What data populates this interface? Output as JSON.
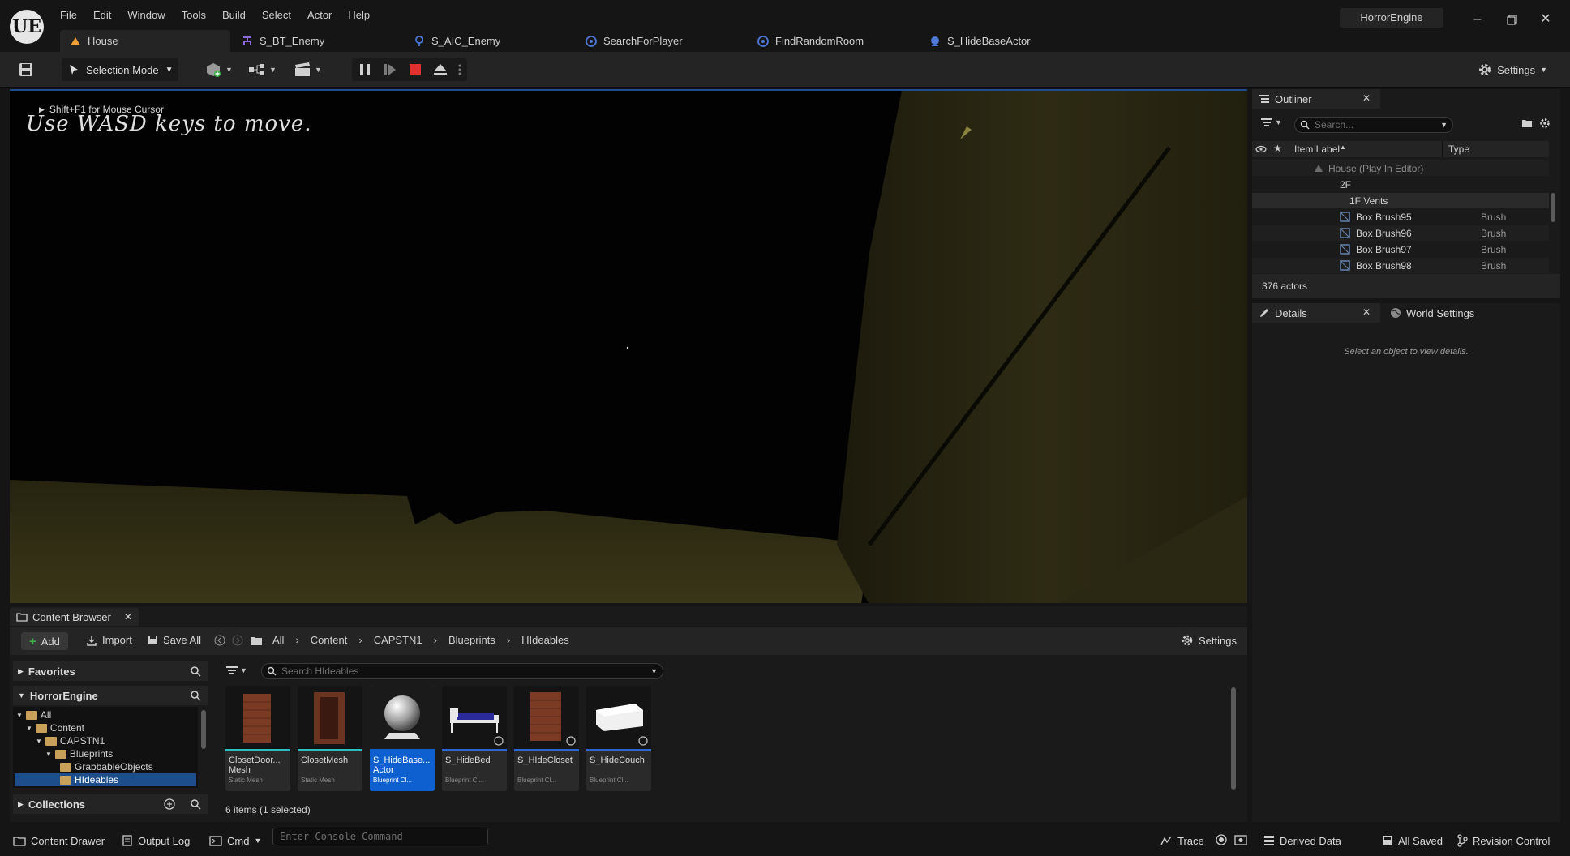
{
  "app": {
    "project": "HorrorEngine",
    "logo": "UE"
  },
  "menu": [
    "File",
    "Edit",
    "Window",
    "Tools",
    "Build",
    "Select",
    "Actor",
    "Help"
  ],
  "tabs": [
    {
      "label": "House",
      "icon": "level-icon",
      "active": true
    },
    {
      "label": "S_BT_Enemy",
      "icon": "behavior-tree-icon"
    },
    {
      "label": "S_AIC_Enemy",
      "icon": "blueprint-icon"
    },
    {
      "label": "SearchForPlayer",
      "icon": "blueprint-icon"
    },
    {
      "label": "FindRandomRoom",
      "icon": "blueprint-icon"
    },
    {
      "label": "S_HideBaseActor",
      "icon": "blueprint-icon"
    }
  ],
  "toolbar": {
    "selection_mode": "Selection Mode",
    "settings": "Settings"
  },
  "viewport": {
    "hint": "Shift+F1 for Mouse Cursor",
    "banner": "Use WASD keys to move."
  },
  "outliner": {
    "title": "Outliner",
    "search_placeholder": "Search...",
    "col_label": "Item Label",
    "col_type": "Type",
    "rows": [
      {
        "label": "House (Play In Editor)",
        "type": ""
      },
      {
        "label": "2F",
        "type": ""
      },
      {
        "label": "1F Vents",
        "type": ""
      },
      {
        "label": "Box Brush95",
        "type": "Brush"
      },
      {
        "label": "Box Brush96",
        "type": "Brush"
      },
      {
        "label": "Box Brush97",
        "type": "Brush"
      },
      {
        "label": "Box Brush98",
        "type": "Brush"
      }
    ],
    "count": "376 actors"
  },
  "details": {
    "title": "Details",
    "world_settings": "World Settings",
    "empty": "Select an object to view details."
  },
  "content_browser": {
    "title": "Content Browser",
    "add": "Add",
    "import": "Import",
    "save_all": "Save All",
    "breadcrumbs": [
      "All",
      "Content",
      "CAPSTN1",
      "Blueprints",
      "HIdeables"
    ],
    "settings": "Settings",
    "favorites": "Favorites",
    "project": "HorrorEngine",
    "collections": "Collections",
    "folders": [
      "All",
      "Content",
      "CAPSTN1",
      "Blueprints",
      "GrabbableObjects",
      "HIdeables"
    ],
    "search_placeholder": "Search HIdeables",
    "assets": [
      {
        "name": "ClosetDoor...",
        "name2": "Mesh",
        "kind": "Static Mesh"
      },
      {
        "name": "ClosetMesh",
        "name2": "",
        "kind": "Static Mesh"
      },
      {
        "name": "S_HideBase...",
        "name2": "Actor",
        "kind": "Blueprint Cl..."
      },
      {
        "name": "S_HideBed",
        "name2": "",
        "kind": "Blueprint Cl..."
      },
      {
        "name": "S_HIdeCloset",
        "name2": "",
        "kind": "Blueprint Cl..."
      },
      {
        "name": "S_HideCouch",
        "name2": "",
        "kind": "Blueprint Cl..."
      }
    ],
    "count": "6 items (1 selected)"
  },
  "statusbar": {
    "content_drawer": "Content Drawer",
    "output_log": "Output Log",
    "cmd": "Cmd",
    "console_placeholder": "Enter Console Command",
    "trace": "Trace",
    "derived_data": "Derived Data",
    "all_saved": "All Saved",
    "revision_control": "Revision Control"
  }
}
